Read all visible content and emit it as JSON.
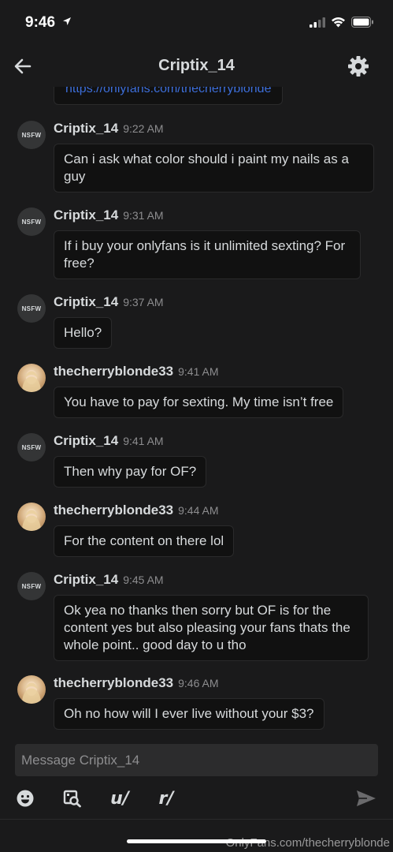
{
  "status_bar": {
    "time": "9:46"
  },
  "header": {
    "title": "Criptix_14"
  },
  "partial_link": "https://onlyfans.com/thecherryblonde",
  "nsfw_label": "NSFW",
  "messages": [
    {
      "user": "Criptix_14",
      "time": "9:22 AM",
      "text": "Can i ask what color should i paint my nails as a guy",
      "avatar": "nsfw"
    },
    {
      "user": "Criptix_14",
      "time": "9:31 AM",
      "text": "If i buy your onlyfans is it unlimited sexting? For free?",
      "avatar": "nsfw"
    },
    {
      "user": "Criptix_14",
      "time": "9:37 AM",
      "text": "Hello?",
      "avatar": "nsfw"
    },
    {
      "user": "thecherryblonde33",
      "time": "9:41 AM",
      "text": "You have to pay for sexting. My time isn’t free",
      "avatar": "photo"
    },
    {
      "user": "Criptix_14",
      "time": "9:41 AM",
      "text": "Then why pay for OF?",
      "avatar": "nsfw"
    },
    {
      "user": "thecherryblonde33",
      "time": "9:44 AM",
      "text": "For the content on there lol",
      "avatar": "photo"
    },
    {
      "user": "Criptix_14",
      "time": "9:45 AM",
      "text": "Ok yea no thanks then sorry but OF is for the content yes but also pleasing your fans thats the whole point.. good day to u tho",
      "avatar": "nsfw"
    },
    {
      "user": "thecherryblonde33",
      "time": "9:46 AM",
      "text": "Oh no how will I ever live without your $3?",
      "avatar": "photo"
    }
  ],
  "composer": {
    "placeholder": "Message Criptix_14"
  },
  "toolbar": {
    "user_label": "u/",
    "subreddit_label": "r/"
  },
  "watermark": "OnlyFans.com/thecherryblonde"
}
